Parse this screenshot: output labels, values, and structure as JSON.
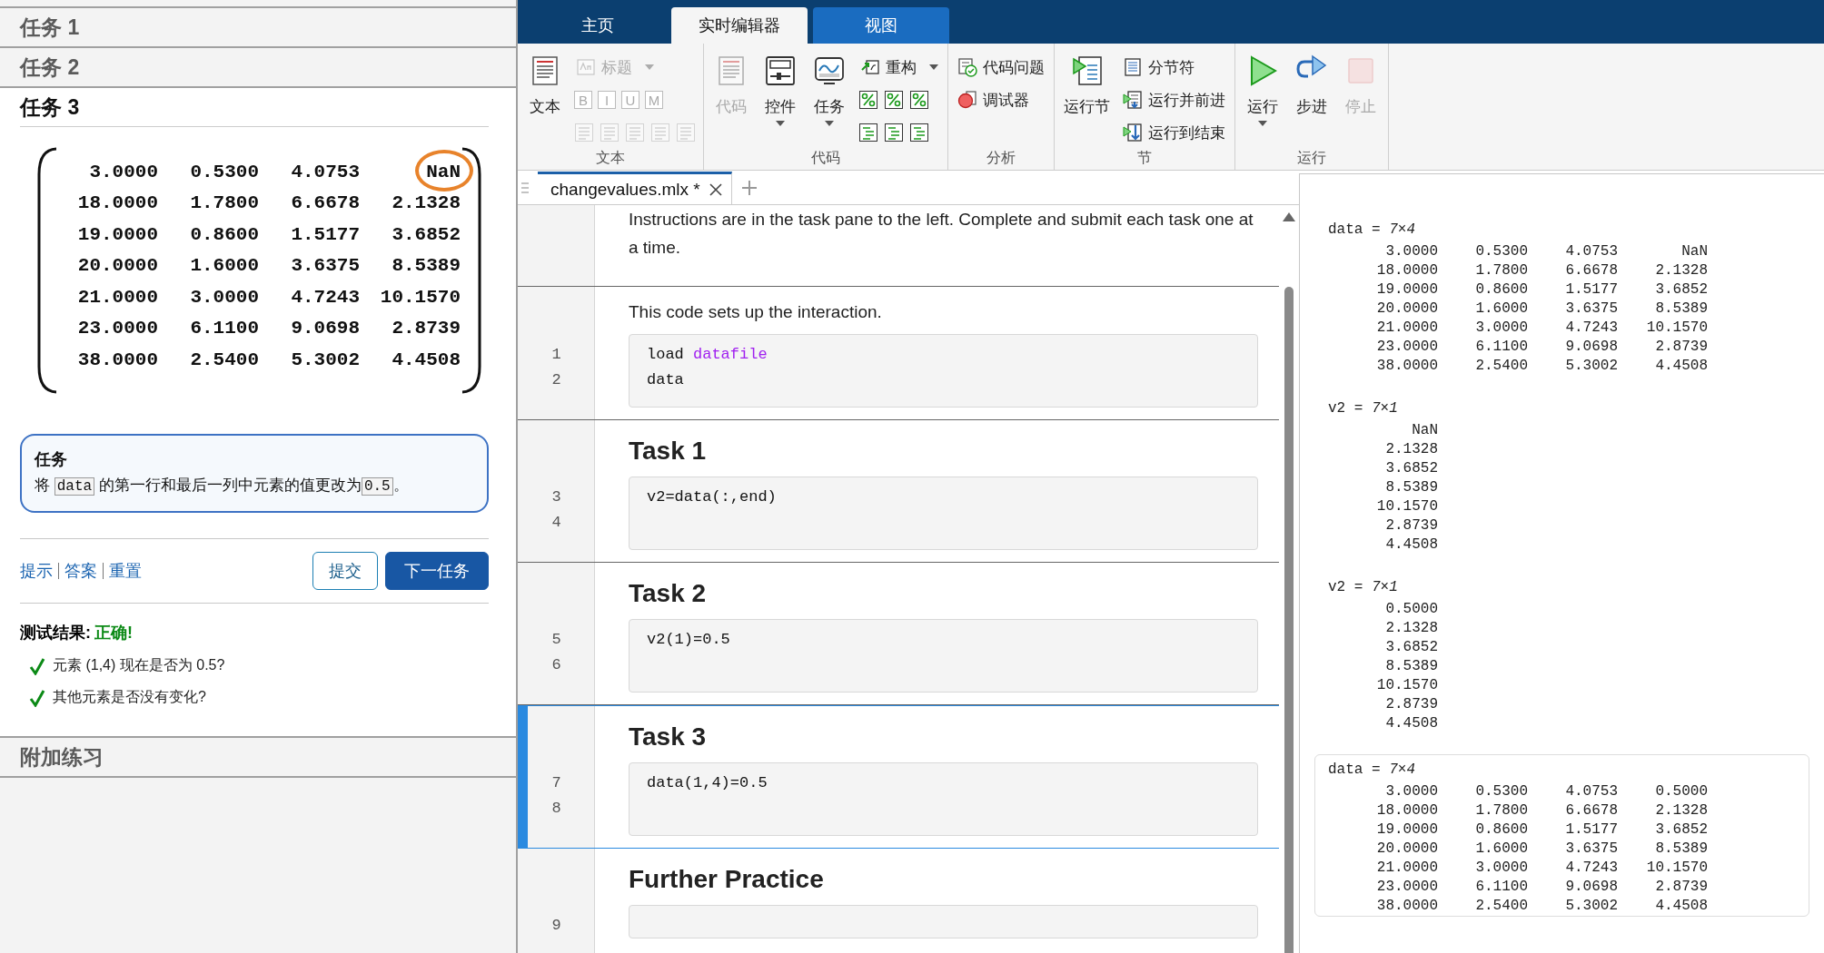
{
  "task_pane": {
    "sections": [
      {
        "title": "任务 1",
        "expanded": false
      },
      {
        "title": "任务 2",
        "expanded": false
      },
      {
        "title": "任务 3",
        "expanded": true
      },
      {
        "title": "附加练习",
        "expanded": false
      }
    ],
    "matrix": {
      "rows": [
        {
          "cells": [
            {
              "value": "3.0000",
              "circled": false
            },
            {
              "value": "0.5300",
              "circled": false
            },
            {
              "value": "4.0753",
              "circled": false
            },
            {
              "value": "NaN",
              "circled": true
            }
          ]
        },
        {
          "cells": [
            {
              "value": "18.0000",
              "circled": false
            },
            {
              "value": "1.7800",
              "circled": false
            },
            {
              "value": "6.6678",
              "circled": false
            },
            {
              "value": "2.1328",
              "circled": false
            }
          ]
        },
        {
          "cells": [
            {
              "value": "19.0000",
              "circled": false
            },
            {
              "value": "0.8600",
              "circled": false
            },
            {
              "value": "1.5177",
              "circled": false
            },
            {
              "value": "3.6852",
              "circled": false
            }
          ]
        },
        {
          "cells": [
            {
              "value": "20.0000",
              "circled": false
            },
            {
              "value": "1.6000",
              "circled": false
            },
            {
              "value": "3.6375",
              "circled": false
            },
            {
              "value": "8.5389",
              "circled": false
            }
          ]
        },
        {
          "cells": [
            {
              "value": "21.0000",
              "circled": false
            },
            {
              "value": "3.0000",
              "circled": false
            },
            {
              "value": "4.7243",
              "circled": false
            },
            {
              "value": "10.1570",
              "circled": false
            }
          ]
        },
        {
          "cells": [
            {
              "value": "23.0000",
              "circled": false
            },
            {
              "value": "6.1100",
              "circled": false
            },
            {
              "value": "9.0698",
              "circled": false
            },
            {
              "value": "2.8739",
              "circled": false
            }
          ]
        },
        {
          "cells": [
            {
              "value": "38.0000",
              "circled": false
            },
            {
              "value": "2.5400",
              "circled": false
            },
            {
              "value": "5.3002",
              "circled": false
            },
            {
              "value": "4.4508",
              "circled": false
            }
          ]
        }
      ]
    },
    "task": {
      "title": "任务",
      "parts": [
        {
          "kind": "text",
          "text": "将 "
        },
        {
          "kind": "code",
          "text": "data"
        },
        {
          "kind": "text",
          "text": " 的第一行和最后一列中元素的值更改为"
        },
        {
          "kind": "code",
          "text": "0.5"
        },
        {
          "kind": "text",
          "text": "。"
        }
      ]
    },
    "links": [
      "提示",
      "答案",
      "重置"
    ],
    "buttons": [
      {
        "label": "提交",
        "kind": "secondary"
      },
      {
        "label": "下一任务",
        "kind": "primary"
      }
    ],
    "results": {
      "label": "测试结果:",
      "status": "正确!",
      "checks": [
        {
          "text": "元素 (1,4) 现在是否为 0.5?",
          "passed": true
        },
        {
          "text": "其他元素是否没有变化?",
          "passed": true
        }
      ]
    }
  },
  "ribbon": {
    "tabs": [
      {
        "label": "主页",
        "selected": false,
        "hovered": false
      },
      {
        "label": "实时编辑器",
        "selected": true,
        "hovered": false
      },
      {
        "label": "视图",
        "selected": false,
        "hovered": true
      }
    ],
    "groups": [
      {
        "label": "文本",
        "items": [
          {
            "kind": "large",
            "label": "文本",
            "disabled": false,
            "dropdown": false
          },
          {
            "kind": "small",
            "label": "标题",
            "disabled": true,
            "dropdown": true
          },
          {
            "kind": "glyph_row",
            "glyphs": [
              "B",
              "I",
              "U",
              "M"
            ],
            "disabled": true
          },
          {
            "kind": "icon_row",
            "disabled": true
          }
        ]
      },
      {
        "label": "代码",
        "items": [
          {
            "kind": "large",
            "label": "代码",
            "disabled": true,
            "dropdown": false
          },
          {
            "kind": "large",
            "label": "控件",
            "disabled": false,
            "dropdown": true
          },
          {
            "kind": "large",
            "label": "任务",
            "disabled": false,
            "dropdown": true
          },
          {
            "kind": "small",
            "label": "重构",
            "disabled": false,
            "dropdown": true
          },
          {
            "kind": "icon_row",
            "disabled": false
          },
          {
            "kind": "icon_row",
            "disabled": false
          }
        ]
      },
      {
        "label": "分析",
        "items": [
          {
            "kind": "small",
            "label": "代码问题",
            "disabled": false,
            "dropdown": false
          },
          {
            "kind": "small",
            "label": "调试器",
            "disabled": false,
            "dropdown": false
          }
        ]
      },
      {
        "label": "节",
        "items": [
          {
            "kind": "large",
            "label": "运行节",
            "disabled": false,
            "dropdown": false
          },
          {
            "kind": "small",
            "label": "分节符",
            "disabled": false,
            "dropdown": false
          },
          {
            "kind": "small",
            "label": "运行并前进",
            "disabled": false,
            "dropdown": false
          },
          {
            "kind": "small",
            "label": "运行到结束",
            "disabled": false,
            "dropdown": false
          }
        ]
      },
      {
        "label": "运行",
        "items": [
          {
            "kind": "large",
            "label": "运行",
            "disabled": false,
            "dropdown": true
          },
          {
            "kind": "large",
            "label": "步进",
            "disabled": false,
            "dropdown": false
          },
          {
            "kind": "large",
            "label": "停止",
            "disabled": true,
            "dropdown": false
          }
        ]
      }
    ]
  },
  "editor": {
    "tabs": [
      {
        "label": "changevalues.mlx *",
        "selected": true
      }
    ],
    "sections": [
      {
        "selected": false,
        "text": "Instructions are in the task pane to the left. Complete and submit each task one at a time."
      },
      {
        "selected": false,
        "text": "This code sets up the interaction.",
        "lines": [
          {
            "number": "1",
            "tokens": [
              {
                "text": "load",
                "kind": "plain"
              },
              {
                "text": "datafile",
                "kind": "string"
              }
            ]
          },
          {
            "number": "2",
            "tokens": [
              {
                "text": "data",
                "kind": "plain"
              }
            ]
          }
        ]
      },
      {
        "selected": false,
        "heading": "Task 1",
        "lines": [
          {
            "number": "3",
            "tokens": [
              {
                "text": "v2=data(:,end)",
                "kind": "plain"
              }
            ]
          },
          {
            "number": "4"
          }
        ]
      },
      {
        "selected": false,
        "heading": "Task 2",
        "lines": [
          {
            "number": "5",
            "tokens": [
              {
                "text": "v2(1)=0.5",
                "kind": "plain"
              }
            ]
          },
          {
            "number": "6"
          }
        ]
      },
      {
        "selected": true,
        "heading": "Task 3",
        "lines": [
          {
            "number": "7",
            "tokens": [
              {
                "text": "data(1,4)=0.5",
                "kind": "plain"
              }
            ]
          },
          {
            "number": "8"
          }
        ]
      },
      {
        "selected": false,
        "heading": "Further Practice",
        "lines": [
          {
            "number": "9"
          }
        ]
      }
    ]
  },
  "output": {
    "blocks": [
      {
        "title": "data = *7×4*",
        "selected": false,
        "rows": [
          [
            "3.0000",
            "0.5300",
            "4.0753",
            "NaN"
          ],
          [
            "18.0000",
            "1.7800",
            "6.6678",
            "2.1328"
          ],
          [
            "19.0000",
            "0.8600",
            "1.5177",
            "3.6852"
          ],
          [
            "20.0000",
            "1.6000",
            "3.6375",
            "8.5389"
          ],
          [
            "21.0000",
            "3.0000",
            "4.7243",
            "10.1570"
          ],
          [
            "23.0000",
            "6.1100",
            "9.0698",
            "2.8739"
          ],
          [
            "38.0000",
            "2.5400",
            "5.3002",
            "4.4508"
          ]
        ]
      },
      {
        "title": "v2 = *7×1*",
        "selected": false,
        "rows": [
          [
            "NaN"
          ],
          [
            "2.1328"
          ],
          [
            "3.6852"
          ],
          [
            "8.5389"
          ],
          [
            "10.1570"
          ],
          [
            "2.8739"
          ],
          [
            "4.4508"
          ]
        ]
      },
      {
        "title": "v2 = *7×1*",
        "selected": false,
        "rows": [
          [
            "0.5000"
          ],
          [
            "2.1328"
          ],
          [
            "3.6852"
          ],
          [
            "8.5389"
          ],
          [
            "10.1570"
          ],
          [
            "2.8739"
          ],
          [
            "4.4508"
          ]
        ]
      },
      {
        "title": "data = *7×4*",
        "selected": true,
        "rows": [
          [
            "3.0000",
            "0.5300",
            "4.0753",
            "0.5000"
          ],
          [
            "18.0000",
            "1.7800",
            "6.6678",
            "2.1328"
          ],
          [
            "19.0000",
            "0.8600",
            "1.5177",
            "3.6852"
          ],
          [
            "20.0000",
            "1.6000",
            "3.6375",
            "8.5389"
          ],
          [
            "21.0000",
            "3.0000",
            "4.7243",
            "10.1570"
          ],
          [
            "23.0000",
            "6.1100",
            "9.0698",
            "2.8739"
          ],
          [
            "38.0000",
            "2.5400",
            "5.3002",
            "4.4508"
          ]
        ]
      }
    ]
  }
}
